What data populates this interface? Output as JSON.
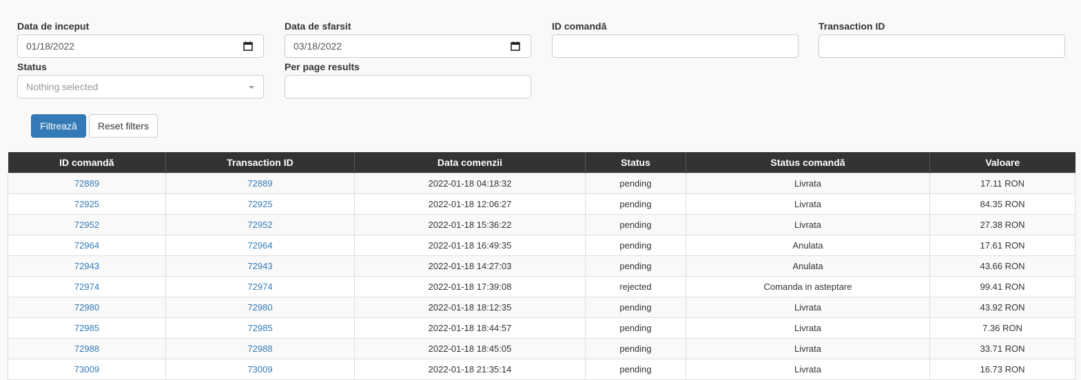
{
  "filters": {
    "start_date": {
      "label": "Data de inceput",
      "value": "01/18/2022"
    },
    "end_date": {
      "label": "Data de sfarsit",
      "value": "03/18/2022"
    },
    "order_id": {
      "label": "ID comandă",
      "value": ""
    },
    "transaction_id": {
      "label": "Transaction ID",
      "value": ""
    },
    "status": {
      "label": "Status",
      "placeholder": "Nothing selected"
    },
    "per_page": {
      "label": "Per page results",
      "value": ""
    }
  },
  "buttons": {
    "filter": "Filtrează",
    "reset": "Reset filters"
  },
  "table": {
    "headers": [
      "ID comandă",
      "Transaction ID",
      "Data comenzii",
      "Status",
      "Status comandă",
      "Valoare"
    ],
    "rows": [
      [
        "72889",
        "72889",
        "2022-01-18 04:18:32",
        "pending",
        "Livrata",
        "17.11 RON"
      ],
      [
        "72925",
        "72925",
        "2022-01-18 12:06:27",
        "pending",
        "Livrata",
        "84.35 RON"
      ],
      [
        "72952",
        "72952",
        "2022-01-18 15:36:22",
        "pending",
        "Livrata",
        "27.38 RON"
      ],
      [
        "72964",
        "72964",
        "2022-01-18 16:49:35",
        "pending",
        "Anulata",
        "17.61 RON"
      ],
      [
        "72943",
        "72943",
        "2022-01-18 14:27:03",
        "pending",
        "Anulata",
        "43.66 RON"
      ],
      [
        "72974",
        "72974",
        "2022-01-18 17:39:08",
        "rejected",
        "Comanda in asteptare",
        "99.41 RON"
      ],
      [
        "72980",
        "72980",
        "2022-01-18 18:12:35",
        "pending",
        "Livrata",
        "43.92 RON"
      ],
      [
        "72985",
        "72985",
        "2022-01-18 18:44:57",
        "pending",
        "Livrata",
        "7.36 RON"
      ],
      [
        "72988",
        "72988",
        "2022-01-18 18:45:05",
        "pending",
        "Livrata",
        "33.71 RON"
      ],
      [
        "73009",
        "73009",
        "2022-01-18 21:35:14",
        "pending",
        "Livrata",
        "16.73 RON"
      ]
    ]
  },
  "icons": {
    "calendar": "calendar-icon",
    "caret": "caret-down-icon"
  },
  "colors": {
    "primary": "#337ab7",
    "header_bg": "#333333",
    "link": "#337ab7"
  }
}
